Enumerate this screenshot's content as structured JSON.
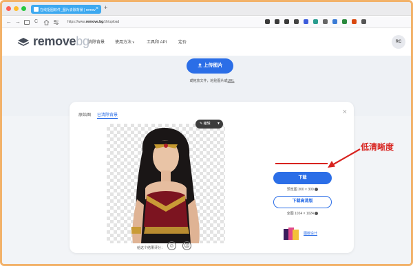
{
  "browser": {
    "tab_title": "在线抠图软件_图片去除背景 | remov",
    "tab_close": "×",
    "new_tab": "+",
    "url_prefix": "https://www.",
    "url_domain": "remove.bg",
    "url_suffix": "/zh/upload",
    "nav": {
      "back": "←",
      "forward": "→",
      "reload": "C"
    },
    "extension_colors": [
      "#3a3a3a",
      "#3a3a3a",
      "#3a3a3a",
      "#444444",
      "#3b5bdb",
      "#2a9d8f",
      "#666666",
      "#3a7bd5",
      "#2b8a3e",
      "#d9480f",
      "#555555"
    ]
  },
  "header": {
    "logo_main": "remove",
    "logo_accent": "bg",
    "menu": [
      "消除背景",
      "使用方法",
      "工具和 API",
      "定价"
    ],
    "menu_chevron": "∨",
    "avatar_initials": "RC"
  },
  "hero": {
    "upload_label": "上传图片",
    "upload_icon": "upload-icon",
    "hint_prefix": "或拖放文件，粘贴图片或",
    "hint_link": "URL"
  },
  "result": {
    "tabs": [
      "原始图",
      "已清除背景"
    ],
    "active_tab": 1,
    "close_label": "×",
    "edit_label": "编辑",
    "rate_label": "给这个结果评分：",
    "download_label": "下载",
    "preview_size": "预览图 300 × 300",
    "download_hd_label": "下载高清版",
    "full_size": "全图 1024 × 1024",
    "design_link": "图版设计"
  },
  "annotation": {
    "text": "低清晰度",
    "color": "#d8231f"
  },
  "colors": {
    "accent": "#2b6ee7",
    "tab_blue": "#3da9f0",
    "frame": "#f2b26a"
  }
}
